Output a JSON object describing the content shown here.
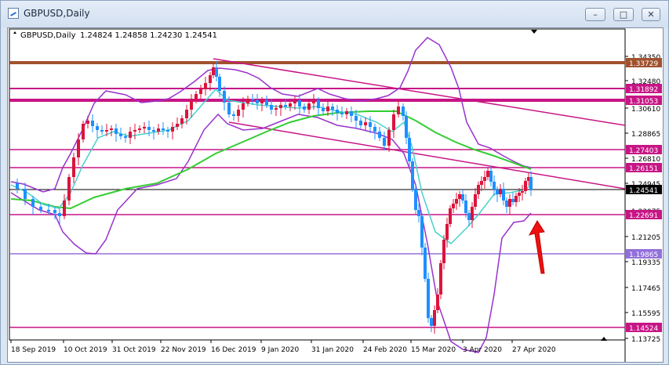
{
  "window": {
    "title": "GBPUSD,Daily",
    "minimize_label": "–",
    "maximize_label": "□",
    "close_label": "✕"
  },
  "chart_info": {
    "symbol_line": "GBPUSD,Daily",
    "ohlc": "1.24824 1.24858 1.24230 1.24541"
  },
  "chart_data": {
    "type": "candlestick",
    "title": "GBPUSD,Daily",
    "ohlc_last": {
      "open": 1.24824,
      "high": 1.24858,
      "low": 1.2423,
      "close": 1.24541
    },
    "price_scale_ticks": [
      "1.34350",
      "1.32480",
      "1.30610",
      "1.28865",
      "1.26810",
      "1.24945",
      "1.23075",
      "1.21205",
      "1.19335",
      "1.17465",
      "1.15595",
      "1.13725"
    ],
    "time_ticks": [
      "18 Sep 2019",
      "10 Oct 2019",
      "31 Oct 2019",
      "22 Nov 2019",
      "16 Dec 2019",
      "9 Jan 2020",
      "31 Jan 2020",
      "24 Feb 2020",
      "15 Mar 2020",
      "3 Apr 2020",
      "27 Apr 2020"
    ],
    "ylim": [
      1.13725,
      1.3565
    ],
    "horizontal_levels": [
      {
        "price": "1.33729",
        "color": "#a0522d"
      },
      {
        "price": "1.31892",
        "color": "#c71585"
      },
      {
        "price": "1.31053",
        "color": "#c71585"
      },
      {
        "price": "1.27403",
        "color": "#c71585"
      },
      {
        "price": "1.26151",
        "color": "#c71585"
      },
      {
        "price": "1.24541",
        "color": "#000000"
      },
      {
        "price": "1.22691",
        "color": "#c71585"
      },
      {
        "price": "1.19865",
        "color": "#9370db"
      },
      {
        "price": "1.14524",
        "color": "#c71585"
      }
    ],
    "indicators": [
      "Bollinger Bands (purple)",
      "Moving average (green)",
      "Moving average (turquoise)"
    ],
    "annotation": "red arrow pointing up",
    "colors": {
      "bull": "#dc143c",
      "bear": "#1e90ff",
      "bands": "#9932cc",
      "ma_slow": "#32cd32",
      "ma_fast": "#48d1cc",
      "trend": "#c71585"
    }
  }
}
